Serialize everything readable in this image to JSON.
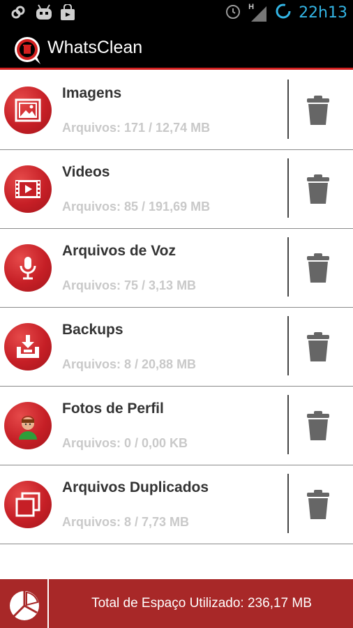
{
  "status_bar": {
    "icons_left": [
      "link-icon",
      "android-icon",
      "shopping-bag-icon"
    ],
    "icons_right": [
      "alarm-icon",
      "signal-icon",
      "sync-icon"
    ],
    "network_type": "H",
    "time": "22h13"
  },
  "app": {
    "title": "WhatsClean",
    "accent_color": "#d32020"
  },
  "items": [
    {
      "title": "Imagens",
      "subtitle": "Arquivos: 171 / 12,74 MB",
      "icon": "image-icon"
    },
    {
      "title": "Videos",
      "subtitle": "Arquivos: 85 / 191,69 MB",
      "icon": "video-icon"
    },
    {
      "title": "Arquivos de Voz",
      "subtitle": "Arquivos: 75 / 3,13 MB",
      "icon": "microphone-icon"
    },
    {
      "title": "Backups",
      "subtitle": "Arquivos: 8 / 20,88 MB",
      "icon": "backup-icon"
    },
    {
      "title": "Fotos de Perfil",
      "subtitle": "Arquivos: 0 / 0,00 KB",
      "icon": "profile-icon"
    },
    {
      "title": "Arquivos Duplicados",
      "subtitle": "Arquivos: 8 / 7,73 MB",
      "icon": "duplicate-icon"
    }
  ],
  "footer": {
    "total_label": "Total de Espaço Utilizado: 236,17 MB",
    "button_icon": "pie-chart-icon",
    "background_color": "#a82828"
  }
}
